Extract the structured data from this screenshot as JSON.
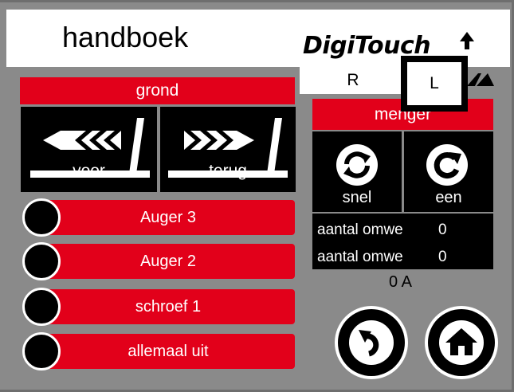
{
  "header": {
    "title": "handboek",
    "brand": "DigiTouch"
  },
  "grond": {
    "label": "grond",
    "buttons": [
      {
        "label": "voor",
        "icon": "forward-icon"
      },
      {
        "label": "terug",
        "icon": "backward-icon"
      }
    ]
  },
  "augers": [
    {
      "label": "Auger 3"
    },
    {
      "label": "Auger 2"
    },
    {
      "label": "schroef 1"
    },
    {
      "label": "allemaal uit"
    }
  ],
  "tabs": [
    {
      "label": "R"
    },
    {
      "label": "L"
    }
  ],
  "menger": {
    "label": "menger",
    "buttons": [
      {
        "label": "snel",
        "icon": "rotate-fast-icon"
      },
      {
        "label": "een",
        "icon": "rotate-once-icon"
      }
    ],
    "rows": [
      {
        "label": "aantal omwe",
        "value": "0"
      },
      {
        "label": "aantal omwe",
        "value": "0"
      }
    ],
    "current": "0 A"
  },
  "nav": {
    "back_icon": "back-icon",
    "home_icon": "home-icon"
  },
  "colors": {
    "red": "#e2001a",
    "black": "#000000",
    "panel": "#8a8a8a",
    "white": "#ffffff"
  }
}
